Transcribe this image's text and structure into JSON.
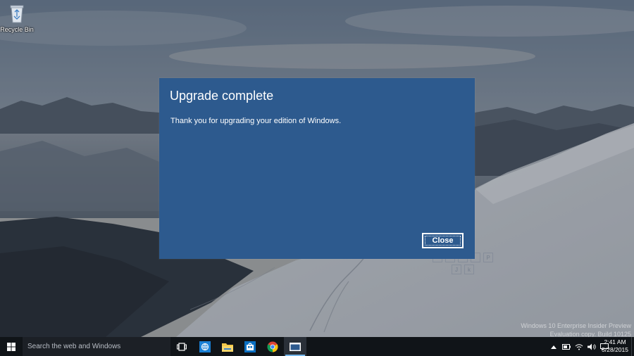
{
  "desktop": {
    "icons": [
      {
        "label": "Recycle Bin",
        "icon": "recycle-bin-icon"
      }
    ]
  },
  "dialog": {
    "title": "Upgrade complete",
    "message": "Thank you for upgrading your edition of Windows.",
    "close_label": "Close",
    "background_color": "#2d5a8e"
  },
  "keyboard_overlay": {
    "keys_row1": [
      "",
      "",
      "",
      "",
      "P"
    ],
    "keys_row2": [
      "J",
      "k"
    ]
  },
  "watermark": {
    "line1": "Windows 10 Enterprise Insider Preview",
    "line2": "Evaluation copy. Build 10125"
  },
  "taskbar": {
    "search_placeholder": "Search the web and Windows",
    "pinned": [
      {
        "name": "task-view",
        "icon": "task-view-icon"
      },
      {
        "name": "internet-explorer",
        "icon": "globe-icon"
      },
      {
        "name": "file-explorer",
        "icon": "folder-icon"
      },
      {
        "name": "store",
        "icon": "store-icon"
      },
      {
        "name": "chrome",
        "icon": "chrome-icon"
      },
      {
        "name": "active-window",
        "icon": "window-icon"
      }
    ],
    "tray_icons": [
      "chevron-up-icon",
      "battery-icon",
      "network-icon",
      "volume-icon",
      "action-center-icon"
    ],
    "time": "2:41 AM",
    "date": "5/28/2015",
    "accent_color": "#76b9ed"
  }
}
